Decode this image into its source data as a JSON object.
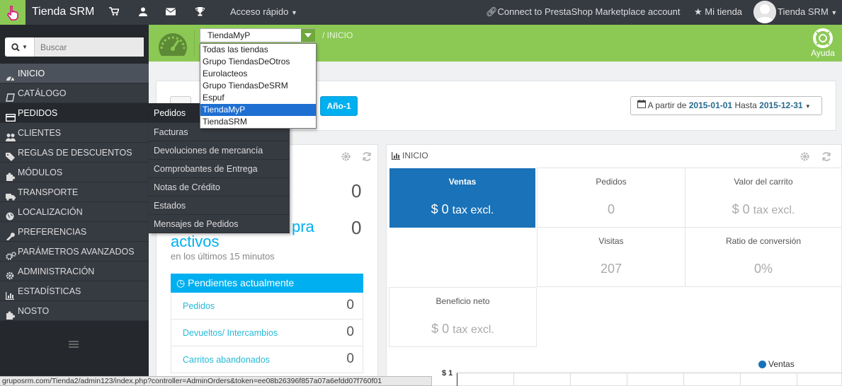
{
  "topbar": {
    "title": "Tienda SRM",
    "quick_access": "Acceso rápido",
    "connect": "Connect to PrestaShop Marketplace account",
    "my_store": "Mi tienda",
    "user": "Tienda SRM",
    "icons": [
      "cart-icon",
      "user-icon",
      "envelope-icon",
      "trophy-icon"
    ]
  },
  "sidebar": {
    "search_placeholder": "Buscar",
    "items": [
      {
        "label": "INICIO",
        "icon": "dashboard-icon"
      },
      {
        "label": "CATÁLOGO",
        "icon": "book-icon"
      },
      {
        "label": "PEDIDOS",
        "icon": "credit-card-icon"
      },
      {
        "label": "CLIENTES",
        "icon": "users-icon"
      },
      {
        "label": "REGLAS DE DESCUENTOS",
        "icon": "tags-icon"
      },
      {
        "label": "MÓDULOS",
        "icon": "puzzle-icon"
      },
      {
        "label": "TRANSPORTE",
        "icon": "truck-icon"
      },
      {
        "label": "LOCALIZACIÓN",
        "icon": "globe-icon"
      },
      {
        "label": "PREFERENCIAS",
        "icon": "wrench-icon"
      },
      {
        "label": "PARÁMETROS AVANZADOS",
        "icon": "cogs-icon"
      },
      {
        "label": "ADMINISTRACIÓN",
        "icon": "cog-icon"
      },
      {
        "label": "ESTADÍSTICAS",
        "icon": "bar-chart-icon"
      },
      {
        "label": "NOSTO",
        "icon": "puzzle-icon"
      }
    ]
  },
  "submenu": {
    "title": "Pedidos",
    "items": [
      "Facturas",
      "Devoluciones de mercancía",
      "Comprobantes de Entrega",
      "Notas de Crédito",
      "Estados",
      "Mensajes de Pedidos"
    ]
  },
  "header": {
    "shop_selected": "TiendaMyP",
    "breadcrumb": "/  INICIO",
    "help": "Ayuda"
  },
  "shop_dropdown": {
    "options": [
      "Todas las tiendas",
      "Grupo TiendasDeOtros",
      "Eurolacteos",
      "Grupo TiendasDeSRM",
      "Espuf",
      "TiendaMyP",
      "TiendaSRM"
    ],
    "selected_index": 5
  },
  "toolbar": {
    "year_button": "Año-1",
    "date_from_label": "A partir de",
    "date_from": "2015-01-01",
    "date_to_label": "Hasta",
    "date_to": "2015-12-31"
  },
  "activity": {
    "value_1": "0",
    "abandoned_label": "pra",
    "active_label": "activos",
    "abandoned_value": "0",
    "minutes_note": "en los últimos 15 minutos",
    "pending_title": "Pendientes actualmente",
    "pending": [
      {
        "label": "Pedidos",
        "value": "0"
      },
      {
        "label": "Devueltos/ Intercambios",
        "value": "0"
      },
      {
        "label": "Carritos abandonados",
        "value": "0"
      }
    ]
  },
  "dashboard": {
    "title": "INICIO",
    "kpis": {
      "ventas": {
        "title": "Ventas",
        "value": "$ 0",
        "unit": "tax excl."
      },
      "pedidos": {
        "title": "Pedidos",
        "value": "0"
      },
      "carrito": {
        "title": "Valor del carrito",
        "value": "$ 0",
        "unit": "tax excl."
      },
      "visitas": {
        "title": "Visitas",
        "value": "207"
      },
      "conversion": {
        "title": "Ratio de conversión",
        "value": "0%"
      },
      "beneficio": {
        "title": "Beneficio neto",
        "value": "$ 0",
        "unit": "tax excl."
      }
    },
    "legend": "Ventas",
    "y_tick": "$ 1"
  },
  "status_bar": "gruposrm.com/Tienda2/admin123/index.php?controller=AdminOrders&token=ee08b26396f857a07a6efdd07f760f01",
  "colors": {
    "green": "#8bc954",
    "dark": "#363a41",
    "blue": "#00aff0",
    "kpi_blue": "#1a72b8"
  }
}
